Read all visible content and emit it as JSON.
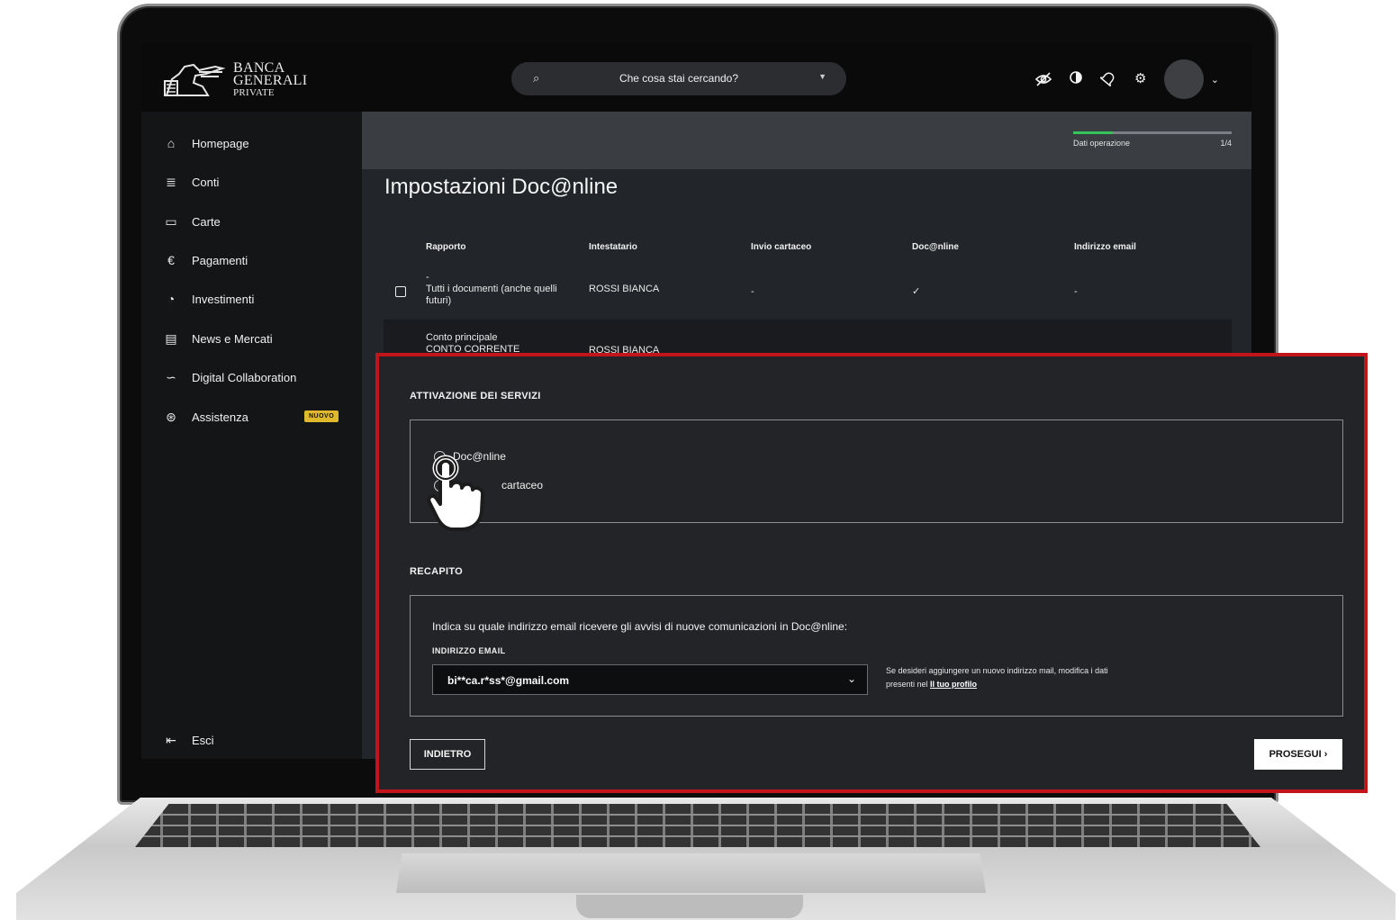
{
  "search": {
    "placeholder": "Che cosa stai cercando?"
  },
  "header_icons": [
    "eye-off-icon",
    "contrast-icon",
    "bell-icon",
    "gear-icon"
  ],
  "logo": {
    "line1": "BANCA",
    "line2": "GENERALI",
    "line3": "PRIVATE"
  },
  "sidebar": {
    "items": [
      {
        "label": "Homepage",
        "icon": "home-icon"
      },
      {
        "label": "Conti",
        "icon": "database-icon"
      },
      {
        "label": "Carte",
        "icon": "card-icon"
      },
      {
        "label": "Pagamenti",
        "icon": "euro-icon"
      },
      {
        "label": "Investimenti",
        "icon": "pie-chart-icon"
      },
      {
        "label": "News e Mercati",
        "icon": "newspaper-icon"
      },
      {
        "label": "Digital Collaboration",
        "icon": "handshake-icon"
      },
      {
        "label": "Assistenza",
        "icon": "lifebuoy-icon",
        "badge": "NUOVO"
      }
    ],
    "logout": "Esci"
  },
  "progress": {
    "label": "Dati operazione",
    "step": "1/4",
    "fraction": 0.25
  },
  "page": {
    "title": "Impostazioni Doc@nline"
  },
  "table": {
    "headers": [
      "Rapporto",
      "Intestatario",
      "Invio cartaceo",
      "Doc@nline",
      "Indirizzo email"
    ],
    "rows": [
      {
        "rapporto_l1": "-",
        "rapporto_l2": "Tutti i documenti (anche quelli",
        "rapporto_l3": "futuri)",
        "intestatario": "ROSSI BIANCA",
        "cartaceo": "-",
        "doconline": "✓",
        "email": "-"
      },
      {
        "rapporto_l1": "Conto principale",
        "rapporto_l2": "CONTO CORRENTE",
        "intestatario": "ROSSI BIANCA"
      }
    ]
  },
  "panel": {
    "activation_title": "ATTIVAZIONE DEI SERVIZI",
    "options": [
      "Doc@nline",
      "cartaceo"
    ],
    "recapito_title": "RECAPITO",
    "instruction": "Indica su quale indirizzo email ricevere gli avvisi di nuove comunicazioni in Doc@nline:",
    "email_label": "INDIRIZZO EMAIL",
    "email_value": "bi**ca.r*ss*@gmail.com",
    "hint_l1": "Se desideri aggiungere un nuovo indirizzo mail, modifica i dati",
    "hint_l2": "presenti nel ",
    "hint_link": "Il tuo profilo",
    "back": "INDIETRO",
    "next": "PROSEGUI ›"
  },
  "colors": {
    "highlight": "#c1151b",
    "progress": "#38c25b",
    "badge": "#e0b92a"
  }
}
